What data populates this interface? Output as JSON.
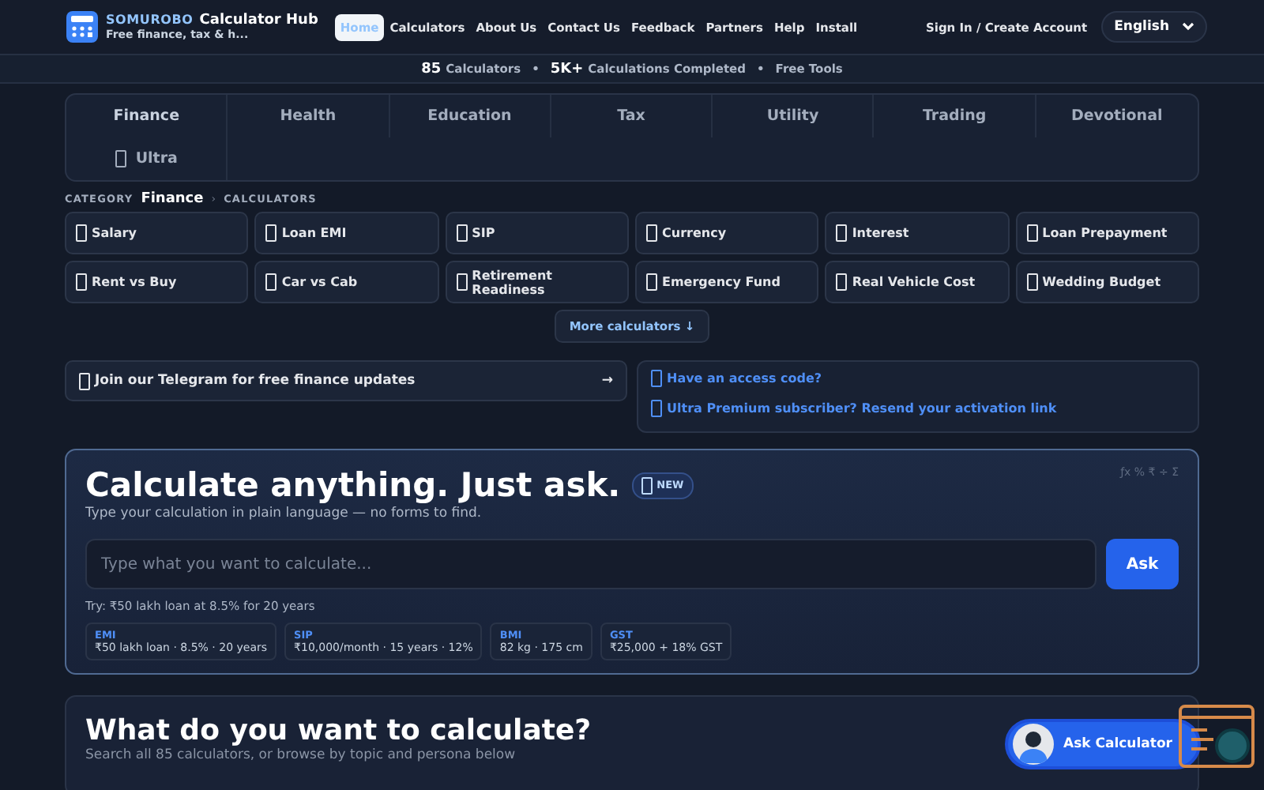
{
  "header": {
    "brand": "SOMUROBO",
    "title": "Calculator Hub",
    "tagline": "Free finance, tax & h...",
    "nav": [
      {
        "label": "Home",
        "selected": true
      },
      {
        "label": "Calculators",
        "selected": false
      },
      {
        "label": "About Us",
        "selected": false
      },
      {
        "label": "Contact Us",
        "selected": false
      },
      {
        "label": "Feedback",
        "selected": false
      },
      {
        "label": "Partners",
        "selected": false
      },
      {
        "label": "Help",
        "selected": false
      },
      {
        "label": "Install",
        "selected": false
      }
    ],
    "sign_in": "Sign In / Create Account",
    "language": "English"
  },
  "stats_bar": [
    {
      "value": "85",
      "label": "Calculators"
    },
    {
      "separator": "•",
      "value": "5K+",
      "label": "Calculations Completed"
    },
    {
      "separator": "•",
      "label": "Free Tools"
    }
  ],
  "category_tabs": [
    {
      "label": "Finance",
      "selected": true,
      "icon": false
    },
    {
      "label": "Health",
      "selected": false,
      "icon": false
    },
    {
      "label": "Education",
      "selected": false,
      "icon": false
    },
    {
      "label": "Tax",
      "selected": false,
      "icon": false
    },
    {
      "label": "Utility",
      "selected": false,
      "icon": false
    },
    {
      "label": "Trading",
      "selected": false,
      "icon": false
    },
    {
      "label": "Devotional",
      "selected": false,
      "icon": false
    },
    {
      "label": "Ultra",
      "selected": false,
      "icon": true
    }
  ],
  "breadcrumb": {
    "prefix": "CATEGORY",
    "category": "Finance",
    "separator": "›",
    "section": "CALCULATORS"
  },
  "calculators": [
    "Salary",
    "Loan EMI",
    "SIP",
    "Currency",
    "Interest",
    "Loan Prepayment",
    "Rent vs Buy",
    "Car vs Cab",
    "Retirement Readiness",
    "Emergency Fund",
    "Real Vehicle Cost",
    "Wedding Budget"
  ],
  "more_button": "More calculators ↓",
  "telegram": {
    "label": "Join our Telegram for free finance updates",
    "arrow": "→"
  },
  "access_links": [
    "Have an access code?",
    "Ultra Premium subscriber? Resend your activation link"
  ],
  "ask_panel": {
    "title": "Calculate anything. Just ask.",
    "badge": "NEW",
    "subtitle": "Type your calculation in plain language — no forms to find.",
    "symbols": "ƒx  %  ₹  ÷  Σ",
    "placeholder": "Type what you want to calculate...",
    "button": "Ask",
    "hint": "Try: ₹50 lakh loan at 8.5% for 20 years",
    "examples": [
      {
        "tag": "EMI",
        "text": "₹50 lakh loan · 8.5% · 20 years"
      },
      {
        "tag": "SIP",
        "text": "₹10,000/month · 15 years · 12%"
      },
      {
        "tag": "BMI",
        "text": "82 kg · 175 cm"
      },
      {
        "tag": "GST",
        "text": "₹25,000 + 18% GST"
      }
    ]
  },
  "search_section": {
    "title": "What do you want to calculate?",
    "subtitle": "Search all 85 calculators, or browse by topic and persona below"
  },
  "floating_button": "Ask Calculator"
}
